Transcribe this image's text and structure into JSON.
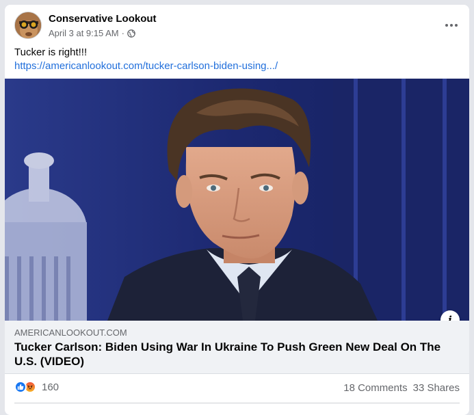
{
  "post": {
    "page_name": "Conservative Lookout",
    "timestamp": "April 3 at 9:15 AM",
    "separator": "·",
    "privacy_icon": "globe-icon",
    "more_icon": "more-horizontal-icon",
    "text": "Tucker is right!!!",
    "link_text": "https://americanlookout.com/tucker-carlson-biden-using.../"
  },
  "link_preview": {
    "domain": "AMERICANLOOKOUT.COM",
    "title": "Tucker Carlson: Biden Using War In Ukraine To Push Green New Deal On The U.S. (VIDEO)",
    "info_icon": "info-icon"
  },
  "stats": {
    "reaction_icons": [
      "like-reaction-icon",
      "angry-reaction-icon"
    ],
    "reaction_count": "160",
    "comments": "18 Comments",
    "shares": "33 Shares"
  },
  "colors": {
    "link": "#216fdb",
    "like": "#1877f2",
    "secondary_text": "#65676b",
    "link_box_bg": "#f0f2f5"
  }
}
